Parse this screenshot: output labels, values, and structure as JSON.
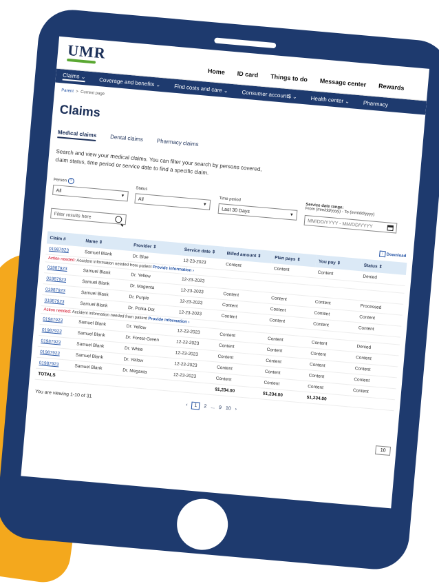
{
  "header": {
    "logo": "UMR",
    "top_nav": [
      "Home",
      "ID card",
      "Things to do",
      "Message center",
      "Rewards"
    ]
  },
  "main_nav": [
    "Claims ⌄",
    "Coverage and benefits ⌄",
    "Find costs and care ⌄",
    "Consumer account$ ⌄",
    "Health center ⌄",
    "Pharmacy"
  ],
  "breadcrumb": {
    "parent": "Parent",
    "separator": ">",
    "current": "Current page"
  },
  "page_title": "Claims",
  "tabs": [
    "Medical claims",
    "Dental claims",
    "Pharmacy claims"
  ],
  "intro": "Search and view your medical claims. You can filter your search by persons covered, claim status, time period or service date to find a specific claim.",
  "filters": {
    "person_label": "Person",
    "person_value": "All",
    "status_label": "Status",
    "status_value": "All",
    "time_label": "Time period",
    "time_value": "Last 30 Days",
    "date_label": "Service date range:",
    "date_hint": "From (mm/dd/yyyy) - To (mm/dd/yyyy)",
    "date_placeholder": "MM/DD/YYYY - MM/DD/YYYY",
    "search_placeholder": "Filter results here"
  },
  "download_label": "Download",
  "table": {
    "headers": [
      "Claim #",
      "Name ⇕",
      "Provider ⇕",
      "Service date ⇕",
      "Billed amount ⇕",
      "Plan pays ⇕",
      "You pay ⇕",
      "Status ⇕"
    ],
    "rows": [
      [
        "01987923",
        "Samuel Blank",
        "Dr. Blue",
        "12-23-2023",
        "Content",
        "Content",
        "Content",
        "Denied"
      ],
      [
        "01987923",
        "Samuel Blank",
        "Dr. Yellow",
        "12-23-2023",
        "",
        "",
        "",
        ""
      ],
      [
        "01987923",
        "Samuel Blank",
        "Dr. Magenta",
        "12-23-2023",
        "Content",
        "Content",
        "Content",
        "Processed"
      ],
      [
        "01987923",
        "Samuel Blank",
        "Dr. Purple",
        "12-23-2023",
        "Content",
        "Content",
        "Content",
        "Content"
      ],
      [
        "01987923",
        "Samuel Blank",
        "Dr. Polka-Dot",
        "12-23-2023",
        "Content",
        "Content",
        "Content",
        "Content"
      ],
      [
        "01987923",
        "Samuel Blank",
        "Dr. Yellow",
        "12-23-2023",
        "Content",
        "Content",
        "Content",
        "Denied"
      ],
      [
        "01987923",
        "Samuel Blank",
        "Dr. Forest-Green",
        "12-23-2023",
        "Content",
        "Content",
        "Content",
        "Content"
      ],
      [
        "01987923",
        "Samuel Blank",
        "Dr. White",
        "12-23-2023",
        "Content",
        "Content",
        "Content",
        "Content"
      ],
      [
        "01987923",
        "Samuel Blank",
        "Dr. Yellow",
        "12-23-2023",
        "Content",
        "Content",
        "Content",
        "Content"
      ],
      [
        "01987923",
        "Samuel Blank",
        "Dr. Meganta",
        "12-23-2023",
        "Content",
        "Content",
        "Content",
        "Content"
      ]
    ],
    "alert_prefix": "Action needed:",
    "alert_text": "Accident information needed from patient",
    "alert_link": "Provide information ›",
    "totals_label": "TOTALS",
    "totals": [
      "$1,234.00",
      "$1,234.00",
      "$1,234.00"
    ]
  },
  "pagination": {
    "viewing": "You are viewing 1-10 of 31",
    "prev": "‹",
    "pages": [
      "1",
      "2",
      "...",
      "9",
      "10"
    ],
    "next": "›",
    "per_page": "10"
  }
}
